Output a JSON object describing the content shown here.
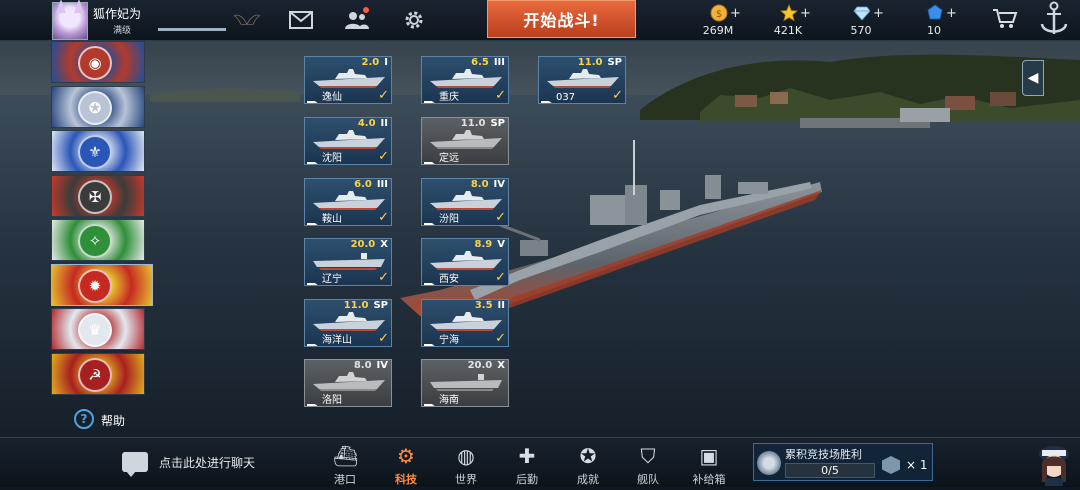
{
  "player": {
    "name": "狐作妃为",
    "level_label": "满级",
    "xp_fraction": 1.0
  },
  "topbar": {
    "start_battle": "开始战斗!",
    "currencies": [
      {
        "icon": "gold-coin-icon",
        "amount": "269M",
        "color": "#f2b23a"
      },
      {
        "icon": "star-icon",
        "amount": "421K",
        "color": "#f5c52e"
      },
      {
        "icon": "diamond-icon",
        "amount": "570",
        "color": "#bfe4ff"
      },
      {
        "icon": "blue-crystal-icon",
        "amount": "10",
        "color": "#3a8fe8"
      }
    ],
    "plus": "+"
  },
  "factions": [
    {
      "name": "faction-uk",
      "bg": "#b23a2c",
      "bg2": "#1e4f9c",
      "glyph": "◉"
    },
    {
      "name": "faction-usa",
      "bg": "#b8c3d6",
      "bg2": "#26457e",
      "glyph": "✪"
    },
    {
      "name": "faction-france",
      "bg": "#2a56b8",
      "bg2": "#dfe6f2",
      "glyph": "⚜"
    },
    {
      "name": "faction-germany",
      "bg": "#3b3b3b",
      "bg2": "#c73a2a",
      "glyph": "✠"
    },
    {
      "name": "faction-italy",
      "bg": "#2f8f3a",
      "bg2": "#e8e8e8",
      "glyph": "✧"
    },
    {
      "name": "faction-china",
      "bg": "#c52a21",
      "bg2": "#e6c230",
      "glyph": "✹",
      "active": true
    },
    {
      "name": "faction-japan-britain",
      "bg": "#e3e7ee",
      "bg2": "#b22a2f",
      "glyph": "♛"
    },
    {
      "name": "faction-soviet",
      "bg": "#a72020",
      "bg2": "#e0b020",
      "glyph": "☭"
    }
  ],
  "help_label": "帮助",
  "ships": [
    {
      "name": "逸仙",
      "tier": "2.0",
      "rank": "I",
      "owned": true,
      "type": "cruiser"
    },
    {
      "name": "重庆",
      "tier": "6.5",
      "rank": "III",
      "owned": true,
      "type": "cruiser"
    },
    {
      "name": "037",
      "tier": "11.0",
      "rank": "SP",
      "owned": true,
      "type": "gunboat"
    },
    {
      "name": "沈阳",
      "tier": "4.0",
      "rank": "II",
      "owned": true,
      "type": "destroyer"
    },
    {
      "name": "定远",
      "tier": "11.0",
      "rank": "SP",
      "owned": false,
      "type": "battleship"
    },
    {
      "name": "鞍山",
      "tier": "6.0",
      "rank": "III",
      "owned": true,
      "type": "destroyer"
    },
    {
      "name": "汾阳",
      "tier": "8.0",
      "rank": "IV",
      "owned": true,
      "type": "destroyer"
    },
    {
      "name": "辽宁",
      "tier": "20.0",
      "rank": "X",
      "owned": true,
      "type": "carrier"
    },
    {
      "name": "西安",
      "tier": "8.9",
      "rank": "V",
      "owned": true,
      "type": "destroyer"
    },
    {
      "name": "海洋山",
      "tier": "11.0",
      "rank": "SP",
      "owned": true,
      "type": "landing"
    },
    {
      "name": "宁海",
      "tier": "3.5",
      "rank": "II",
      "owned": true,
      "type": "cruiser"
    },
    {
      "name": "洛阳",
      "tier": "8.0",
      "rank": "IV",
      "owned": false,
      "type": "destroyer"
    },
    {
      "name": "海南",
      "tier": "20.0",
      "rank": "X",
      "owned": false,
      "type": "carrier"
    }
  ],
  "bottombar": {
    "chat_placeholder": "点击此处进行聊天",
    "nav": [
      {
        "label": "港口",
        "icon": "harbor-icon",
        "glyph": "⛴"
      },
      {
        "label": "科技",
        "icon": "tech-icon",
        "glyph": "⚙",
        "active": true
      },
      {
        "label": "世界",
        "icon": "globe-icon",
        "glyph": "◍"
      },
      {
        "label": "后勤",
        "icon": "logistics-icon",
        "glyph": "✚"
      },
      {
        "label": "成就",
        "icon": "achievement-icon",
        "glyph": "✪"
      },
      {
        "label": "舰队",
        "icon": "fleet-icon",
        "glyph": "⛉"
      },
      {
        "label": "补给箱",
        "icon": "supply-box-icon",
        "glyph": "▣"
      }
    ],
    "arena": {
      "title": "累积竞技场胜利",
      "progress": "0/5",
      "reward_multiplier": "× 1"
    }
  }
}
